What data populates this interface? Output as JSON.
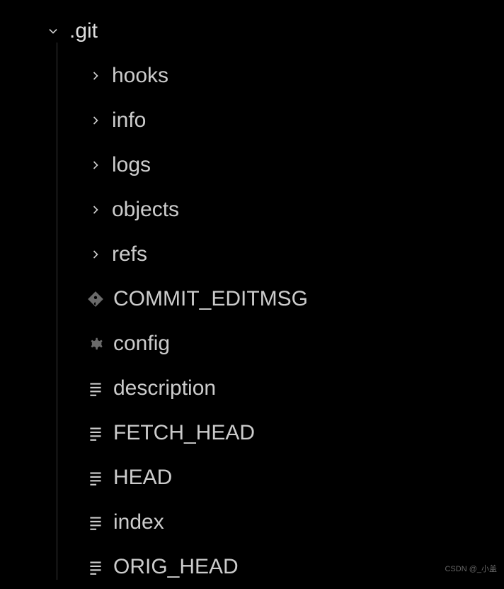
{
  "tree": {
    "root": {
      "label": ".git",
      "expanded": true
    },
    "children": [
      {
        "type": "folder",
        "label": "hooks",
        "icon": "chevron-right"
      },
      {
        "type": "folder",
        "label": "info",
        "icon": "chevron-right"
      },
      {
        "type": "folder",
        "label": "logs",
        "icon": "chevron-right"
      },
      {
        "type": "folder",
        "label": "objects",
        "icon": "chevron-right"
      },
      {
        "type": "folder",
        "label": "refs",
        "icon": "chevron-right"
      },
      {
        "type": "file",
        "label": "COMMIT_EDITMSG",
        "icon": "git"
      },
      {
        "type": "file",
        "label": "config",
        "icon": "gear"
      },
      {
        "type": "file",
        "label": "description",
        "icon": "text-file"
      },
      {
        "type": "file",
        "label": "FETCH_HEAD",
        "icon": "text-file"
      },
      {
        "type": "file",
        "label": "HEAD",
        "icon": "text-file"
      },
      {
        "type": "file",
        "label": "index",
        "icon": "text-file"
      },
      {
        "type": "file",
        "label": "ORIG_HEAD",
        "icon": "text-file"
      }
    ]
  },
  "watermark": "CSDN @_小盖"
}
